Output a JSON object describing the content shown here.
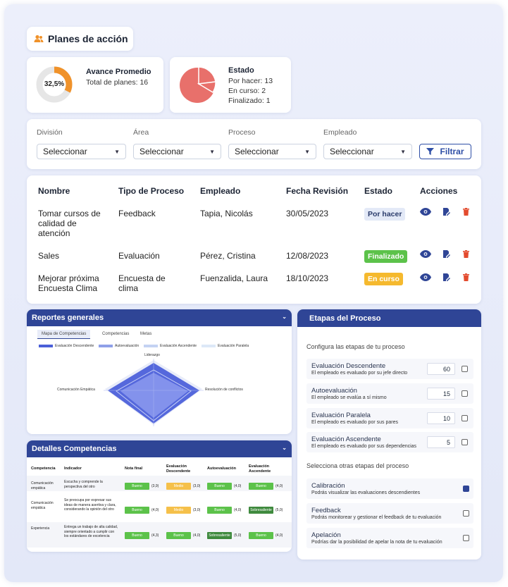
{
  "title": "Planes de acción",
  "kpi_avance": {
    "percent_label": "32,5%",
    "percent": 32.5,
    "title": "Avance Promedio",
    "total": "Total de planes: 16"
  },
  "kpi_estado": {
    "title": "Estado",
    "por_hacer": "Por hacer: 13",
    "en_curso": "En curso: 2",
    "finalizado": "Finalizado: 1"
  },
  "filters": {
    "division": {
      "label": "División",
      "value": "Seleccionar"
    },
    "area": {
      "label": "Área",
      "value": "Seleccionar"
    },
    "proceso": {
      "label": "Proceso",
      "value": "Seleccionar"
    },
    "empleado": {
      "label": "Empleado",
      "value": "Seleccionar"
    },
    "filter_button": "Filtrar"
  },
  "table": {
    "headers": [
      "Nombre",
      "Tipo de Proceso",
      "Empleado",
      "Fecha Revisión",
      "Estado",
      "Acciones"
    ],
    "rows": [
      {
        "nombre": "Tomar cursos de calidad de atención",
        "tipo": "Feedback",
        "empleado": "Tapia, Nicolás",
        "fecha": "30/05/2023",
        "estado": "Por hacer"
      },
      {
        "nombre": "Sales",
        "tipo": "Evaluación",
        "empleado": "Pérez, Cristina",
        "fecha": "12/08/2023",
        "estado": "Finalizado"
      },
      {
        "nombre": "Mejorar próxima Encuesta Clima",
        "tipo": "Encuesta de clima",
        "empleado": "Fuenzalida, Laura",
        "fecha": "18/10/2023",
        "estado": "En curso"
      }
    ]
  },
  "reportes": {
    "title": "Reportes generales",
    "tabs": [
      "Mapa de Competencias",
      "Competencias",
      "Metas"
    ],
    "legend": [
      {
        "name": "Evaluación Descendente",
        "color": "#4a5fd8"
      },
      {
        "name": "Autoevaluación",
        "color": "#8fa0e8"
      },
      {
        "name": "Evaluación Ascendente",
        "color": "#c4d2f3"
      },
      {
        "name": "Evaluación Paralela",
        "color": "#dde8f7"
      }
    ],
    "axes": [
      "Liderazgo",
      "Comunicación Empática",
      "Resolución de conflictos"
    ]
  },
  "detalles": {
    "title": "Detalles Competencias",
    "headers": [
      "Competencia",
      "Indicador",
      "Nota final",
      "Evaluación Descendente",
      "Autoevaluación",
      "Evaluación Ascendente"
    ],
    "rows": [
      {
        "competencia": "Comunicación empática",
        "indicador": "Escucha y comprende la perspectiva del otro",
        "cells": [
          [
            "Bueno",
            "(3,9)"
          ],
          [
            "Medio",
            "(3,0)"
          ],
          [
            "Bueno",
            "(4,0)"
          ],
          [
            "Bueno",
            "(4,0)"
          ]
        ]
      },
      {
        "competencia": "Comunicación empática",
        "indicador": "Se preocupa por expresar sus ideas de manera asertiva y clara, considerando la opinión del otro",
        "cells": [
          [
            "Bueno",
            "(4,0)"
          ],
          [
            "Medio",
            "(3,0)"
          ],
          [
            "Bueno",
            "(4,0)"
          ],
          [
            "Sobresaliente",
            "(5,0)"
          ]
        ]
      },
      {
        "competencia": "Experiencia",
        "indicador": "Entrega un trabajo de alta calidad, siempre orientado a cumplir con los estándares de excelencia",
        "cells": [
          [
            "Bueno",
            "(4,3)"
          ],
          [
            "Bueno",
            "(4,0)"
          ],
          [
            "Sobresaliente",
            "(5,0)"
          ],
          [
            "Bueno",
            "(4,0)"
          ]
        ]
      }
    ]
  },
  "etapas": {
    "title": "Etapas del Proceso",
    "configura": "Configura las etapas de tu proceso",
    "items": [
      {
        "name": "Evaluación Descendente",
        "desc": "El empleado es evaluado por su jefe directo",
        "value": "60"
      },
      {
        "name": "Autoevaluación",
        "desc": "El empleado se evalúa a sí mismo",
        "value": "15"
      },
      {
        "name": "Evaluación Paralela",
        "desc": "El empleado es evaluado por sus pares",
        "value": "10"
      },
      {
        "name": "Evaluación Ascendente",
        "desc": "El empleado es evaluado por sus dependencias",
        "value": "5"
      }
    ],
    "otras": "Selecciona otras etapas del proceso",
    "extras": [
      {
        "name": "Calibración",
        "desc": "Podrás visualizar las evaluaciones descendientes",
        "checked": true
      },
      {
        "name": "Feedback",
        "desc": "Podrás monitorear y gestionar el feedback de tu evaluación",
        "checked": false
      },
      {
        "name": "Apelación",
        "desc": "Podrías dar la posibilidad de apelar la nota de tu evaluación",
        "checked": false
      }
    ]
  }
}
